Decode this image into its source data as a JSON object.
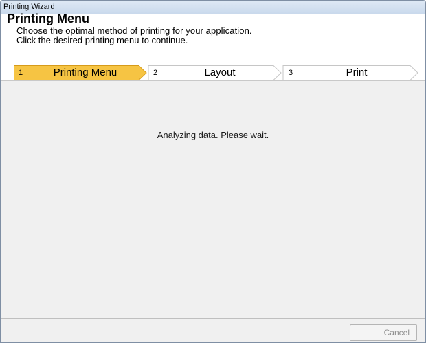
{
  "window": {
    "title": "Printing Wizard"
  },
  "header": {
    "title": "Printing Menu",
    "line1": "Choose the optimal method of printing for your application.",
    "line2": "Click the desired printing menu to continue."
  },
  "steps": [
    {
      "num": "1",
      "label": "Printing Menu",
      "active": true
    },
    {
      "num": "2",
      "label": "Layout",
      "active": false
    },
    {
      "num": "3",
      "label": "Print",
      "active": false
    }
  ],
  "content": {
    "status": "Analyzing data. Please wait."
  },
  "footer": {
    "cancel_label": "Cancel",
    "cancel_enabled": false
  },
  "colors": {
    "active_step": "#f5c242",
    "active_step_border": "#d49a1a",
    "inactive_step_border": "#c8c8c8"
  }
}
